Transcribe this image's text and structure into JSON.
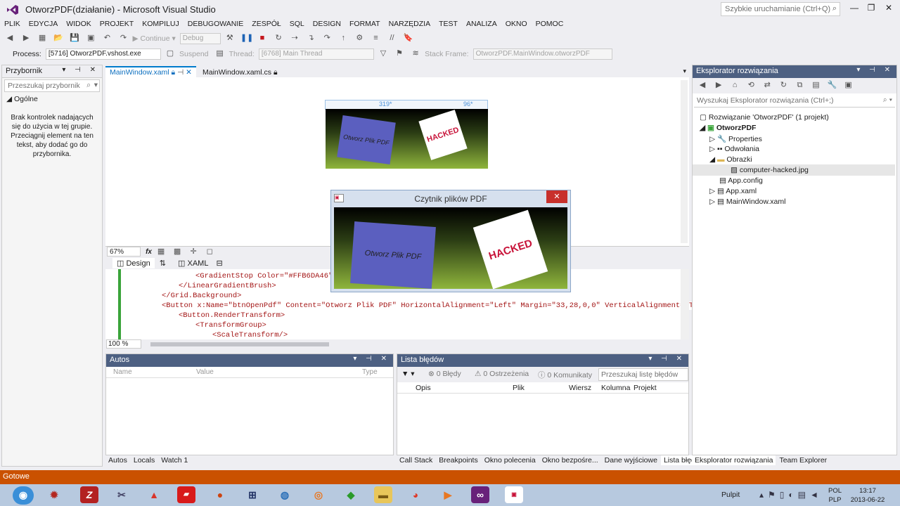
{
  "window": {
    "title": "OtworzPDF(działanie) - Microsoft Visual Studio",
    "logo": "vs-logo-icon",
    "quick_launch_placeholder": "Szybkie uruchamianie (Ctrl+Q)"
  },
  "menu": [
    "PLIK",
    "EDYCJA",
    "WIDOK",
    "PROJEKT",
    "KOMPILUJ",
    "DEBUGOWANIE",
    "ZESPÓŁ",
    "SQL",
    "DESIGN",
    "FORMAT",
    "NARZĘDZIA",
    "TEST",
    "ANALIZA",
    "OKNO",
    "POMOC"
  ],
  "toolbar": {
    "continue_label": "Continue",
    "config_value": "Debug"
  },
  "debug_bar": {
    "process_label": "Process:",
    "process_value": "[5716] OtworzPDF.vshost.exe",
    "suspend_label": "Suspend",
    "thread_label": "Thread:",
    "thread_value": "[6768] Main Thread",
    "stack_label": "Stack Frame:",
    "stack_value": "OtworzPDF.MainWindow.otworzPDF"
  },
  "toolbox": {
    "title": "Przybornik",
    "search_placeholder": "Przeszukaj przybornik",
    "group": "Ogólne",
    "empty_text": "Brak kontrolek nadających się do użycia w tej grupie. Przeciągnij element na ten tekst, aby dodać go do przybornika."
  },
  "doc_tabs": [
    {
      "label": "MainWindow.xaml"
    },
    {
      "label": "MainWindow.xaml.cs"
    }
  ],
  "designer": {
    "dim_left": "319*",
    "dim_right": "96*",
    "button_text": "Otworz Plik PDF",
    "hacked_text": "HACKED",
    "zoom": "67%",
    "fx": "fx",
    "tab_design": "Design",
    "tab_xaml": "XAML"
  },
  "code": {
    "lines": [
      "<GradientStop Color=\"#FFB6DA46\"",
      "</LinearGradientBrush>",
      "</Grid.Background>",
      "<Button x:Name=\"btnOpenPdf\" Content=\"Otworz Plik PDF\" HorizontalAlignment=\"Left\" Margin=\"33,28,0,0\" VerticalAlignment=\"Top\"",
      "<Button.RenderTransform>",
      "<TransformGroup>",
      "<ScaleTransform/>"
    ],
    "zoom": "100 %"
  },
  "app_window": {
    "title": "Czytnik plików PDF",
    "button_text": "Otworz Plik PDF",
    "hacked_text": "HACKED",
    "close": "✕"
  },
  "autos": {
    "title": "Autos",
    "columns": [
      "Name",
      "Value",
      "Type"
    ],
    "tabs": [
      "Autos",
      "Locals",
      "Watch 1"
    ]
  },
  "errors": {
    "title": "Lista błędów",
    "errors_label": "0 Błędy",
    "warnings_label": "0 Ostrzeżenia",
    "messages_label": "0 Komunikaty",
    "search_placeholder": "Przeszukaj listę błędów",
    "columns": [
      "Opis",
      "Plik",
      "Wiersz",
      "Kolumna",
      "Projekt"
    ],
    "tabs": [
      "Call Stack",
      "Breakpoints",
      "Okno polecenia",
      "Okno bezpośre...",
      "Dane wyjściowe",
      "Lista błędów"
    ]
  },
  "solution": {
    "title": "Eksplorator rozwiązania",
    "search_placeholder": "Wyszukaj Eksplorator rozwiązania (Ctrl+;)",
    "items": [
      {
        "label": "Rozwiązanie 'OtworzPDF' (1 projekt)"
      },
      {
        "label": "OtworzPDF"
      },
      {
        "label": "Properties"
      },
      {
        "label": "Odwołania"
      },
      {
        "label": "Obrazki"
      },
      {
        "label": "computer-hacked.jpg"
      },
      {
        "label": "App.config"
      },
      {
        "label": "App.xaml"
      },
      {
        "label": "MainWindow.xaml"
      }
    ],
    "tabs": [
      "Eksplorator rozwiązania",
      "Team Explorer"
    ]
  },
  "status": {
    "text": "Gotowe"
  },
  "taskbar": {
    "pulpit": "Pulpit",
    "lang": "POL",
    "layout": "PLP",
    "time": "13:17",
    "date": "2013-06-22",
    "z_label": "Z"
  }
}
